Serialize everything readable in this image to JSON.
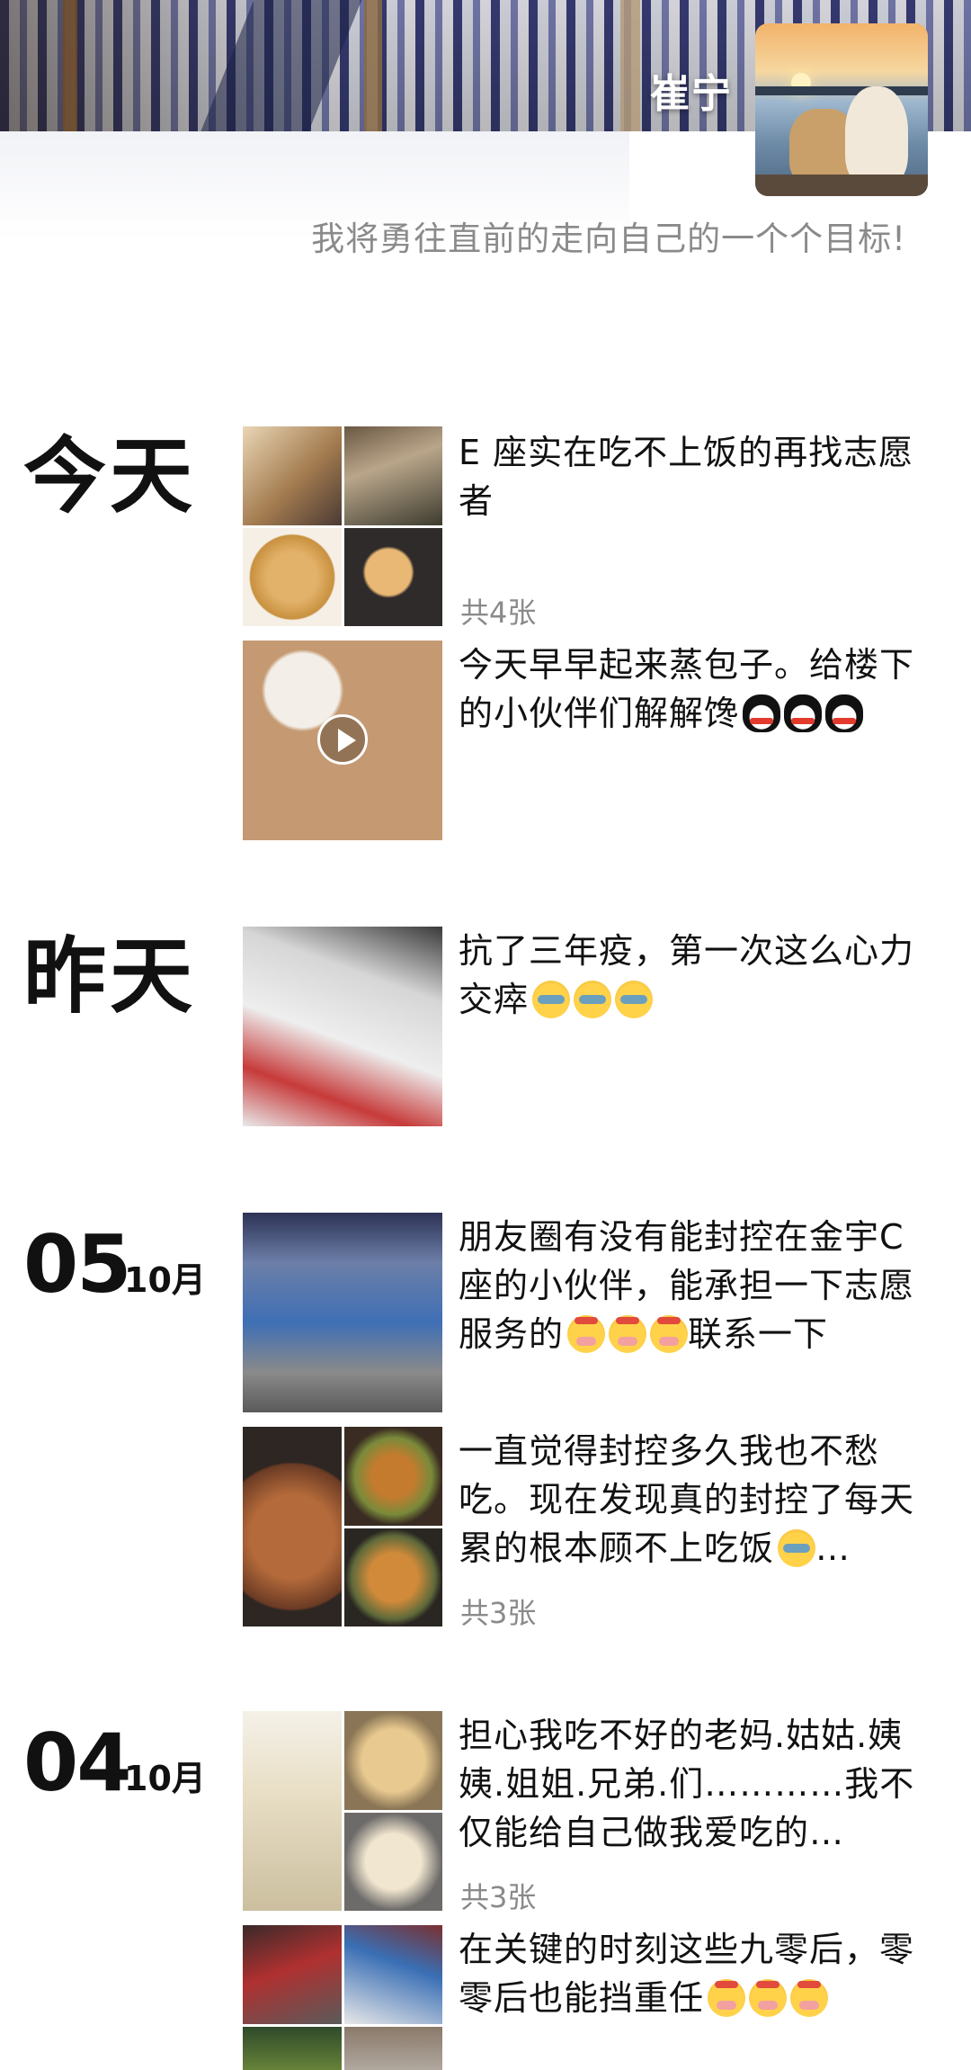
{
  "profile": {
    "username": "崔宁",
    "signature": "我将勇往直前的走向自己的一个个目标!"
  },
  "timeline": {
    "today_label": "今天",
    "yesterday_label": "昨天",
    "date_0510": {
      "day": "05",
      "month": "10月"
    },
    "date_0410": {
      "day": "04",
      "month": "10月"
    }
  },
  "posts": [
    {
      "text": "E 座实在吃不上饭的再找志愿者",
      "count": "共4张"
    },
    {
      "text": "今天早早起来蒸包子。给楼下的小伙伴们解解馋",
      "emoji": [
        "penguin-emoji",
        "penguin-emoji",
        "penguin-emoji"
      ]
    },
    {
      "text": "抗了三年疫，第一次这么心力交瘁",
      "emoji": [
        "crying-emoji",
        "crying-emoji",
        "crying-emoji"
      ]
    },
    {
      "text": "朋友圈有没有能封控在金宇C座的小伙伴，能承担一下志愿服务的",
      "text_after": "联系一下",
      "emoji": [
        "shush-emoji",
        "shush-emoji",
        "shush-emoji"
      ]
    },
    {
      "text": "一直觉得封控多久我也不愁吃。现在发现真的封控了每天累的根本顾不上吃饭",
      "text_after": "…",
      "count": "共3张"
    },
    {
      "text": "担心我吃不好的老妈.姑姑.姨姨.姐姐.兄弟.们…………我不仅能给自己做我爱吃的…",
      "count": "共3张"
    },
    {
      "text": "在关键的时刻这些九零后，零零后也能挡重任",
      "emoji": [
        "shush-emoji",
        "shush-emoji",
        "shush-emoji"
      ]
    }
  ]
}
